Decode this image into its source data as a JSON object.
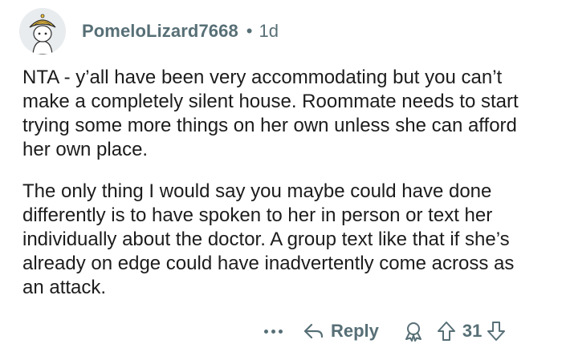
{
  "comment": {
    "author": "PomeloLizard7668",
    "separator": "•",
    "age": "1d",
    "paragraphs": [
      "NTA - y’all have been very accommodating but you can’t make a completely silent house. Roommate needs to start trying some more things on her own unless she can afford her own place.",
      "The only thing I would say you maybe could have done differently is to have spoken to her in person or text her individually about the doctor. A group text like that if she’s already on edge could have inadvertently come across as an attack."
    ]
  },
  "actions": {
    "more_icon": "ellipsis-icon",
    "reply_icon": "reply-arrow-icon",
    "reply_label": "Reply",
    "award_icon": "award-icon",
    "upvote_icon": "upvote-arrow-icon",
    "vote_count": "31",
    "downvote_icon": "downvote-arrow-icon"
  },
  "colors": {
    "text": "#1c1c1c",
    "meta": "#576f76",
    "avatar_bg": "#e9ecee",
    "avatar_hat": "#f7c63a"
  }
}
